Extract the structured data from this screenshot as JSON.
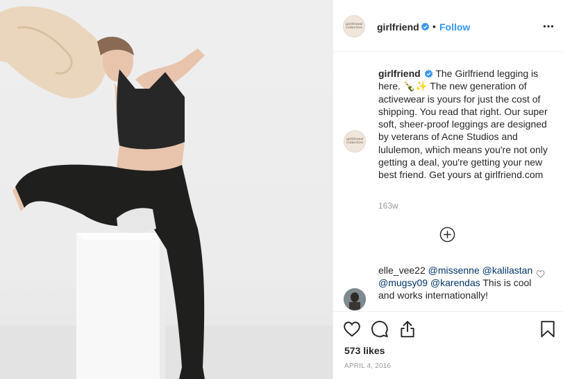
{
  "post": {
    "username": "girlfriend",
    "follow_label": "Follow",
    "separator": "•",
    "avatar_text": "girlfriend collective",
    "caption_username": "girlfriend",
    "caption_text": "The Girlfriend legging is here. 🍾✨ The new generation of activewear is yours for just the cost of shipping. You read that right. Our super soft, sheer-proof leggings are designed by veterans of Acne Studios and lululemon, which means you're not only getting a deal, you're getting your new best friend. Get yours at girlfriend.com",
    "caption_age": "163w",
    "likes": "573 likes",
    "date": "APRIL 4, 2016"
  },
  "reply": {
    "username": "elle_vee22",
    "mentions": [
      "@missenne",
      "@kalilastan",
      "@mugsy09",
      "@karendas"
    ],
    "text": "This is cool and works internationally!"
  },
  "icons": {
    "verified": "verified-badge-icon",
    "more": "more-options-icon",
    "load_more": "load-more-comments-icon",
    "like": "heart-icon",
    "comment": "comment-icon",
    "share": "share-icon",
    "save": "bookmark-icon"
  },
  "colors": {
    "accent": "#3897f0",
    "mention": "#003569",
    "muted": "#999999",
    "text": "#262626"
  }
}
